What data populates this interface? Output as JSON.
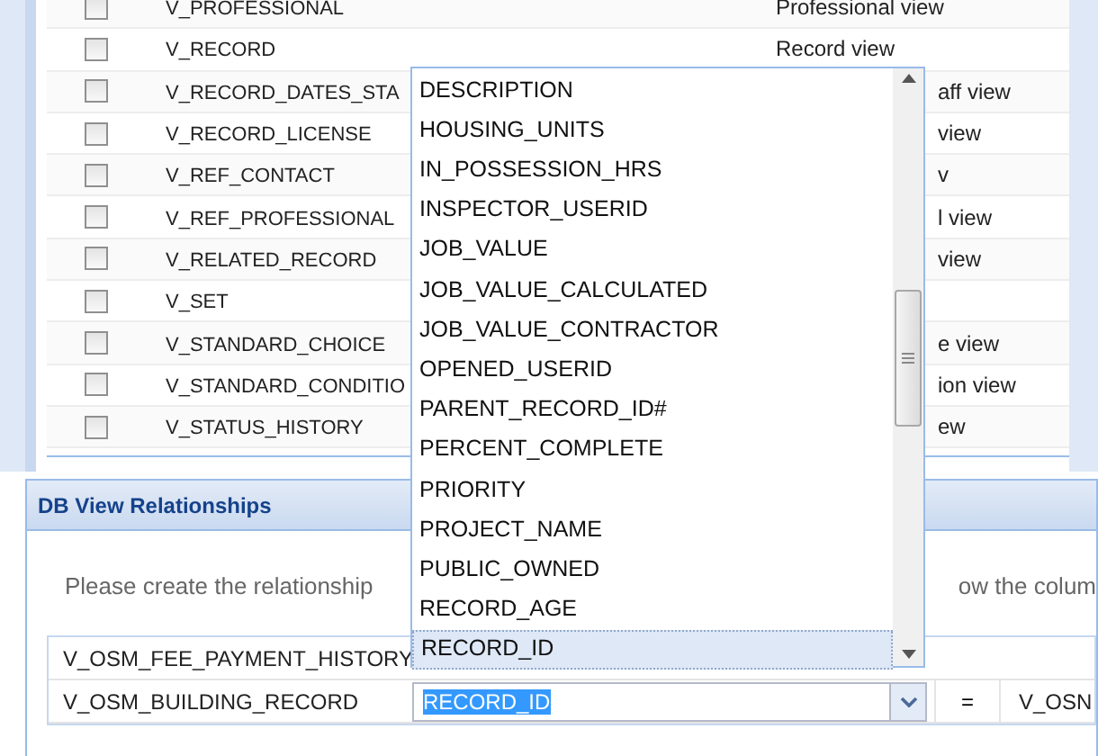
{
  "views": [
    {
      "name": "V_PROFESSIONAL",
      "description": "Professional view",
      "checked": false
    },
    {
      "name": "V_RECORD",
      "description": "Record view",
      "checked": false
    },
    {
      "name": "V_RECORD_DATES_STA",
      "description": "aff view",
      "checked": false
    },
    {
      "name": "V_RECORD_LICENSE",
      "description": "view",
      "checked": false
    },
    {
      "name": "V_REF_CONTACT",
      "description": "v",
      "checked": false
    },
    {
      "name": "V_REF_PROFESSIONAL",
      "description": "l view",
      "checked": false
    },
    {
      "name": "V_RELATED_RECORD",
      "description": "view",
      "checked": false
    },
    {
      "name": "V_SET",
      "checked": false
    },
    {
      "name": "V_STANDARD_CHOICE",
      "description": "e view",
      "checked": false
    },
    {
      "name": "V_STANDARD_CONDITIO",
      "description": "ion view",
      "checked": false
    },
    {
      "name": "V_STATUS_HISTORY",
      "description": "ew",
      "checked": false
    }
  ],
  "relationships": {
    "title": "DB View Relationships",
    "instruction_left": "Please create the relationship",
    "instruction_right": "ow the colum",
    "rows": [
      {
        "view": "V_OSM_FEE_PAYMENT_HISTORY"
      },
      {
        "view": "V_OSM_BUILDING_RECORD",
        "column": "RECORD_ID",
        "operator": "=",
        "other_view": "V_OSN"
      }
    ]
  },
  "column_dropdown": {
    "options": [
      {
        "label": "DESCRIPTION",
        "selected": false
      },
      {
        "label": "HOUSING_UNITS",
        "selected": false
      },
      {
        "label": "IN_POSSESSION_HRS",
        "selected": false
      },
      {
        "label": "INSPECTOR_USERID",
        "selected": false
      },
      {
        "label": "JOB_VALUE",
        "selected": false
      },
      {
        "label": "JOB_VALUE_CALCULATED",
        "selected": false
      },
      {
        "label": "JOB_VALUE_CONTRACTOR",
        "selected": false
      },
      {
        "label": "OPENED_USERID",
        "selected": false
      },
      {
        "label": "PARENT_RECORD_ID#",
        "selected": false
      },
      {
        "label": "PERCENT_COMPLETE",
        "selected": false
      },
      {
        "label": "PRIORITY",
        "selected": false
      },
      {
        "label": "PROJECT_NAME",
        "selected": false
      },
      {
        "label": "PUBLIC_OWNED",
        "selected": false
      },
      {
        "label": "RECORD_AGE",
        "selected": false
      },
      {
        "label": "RECORD_ID",
        "selected": true
      }
    ]
  }
}
